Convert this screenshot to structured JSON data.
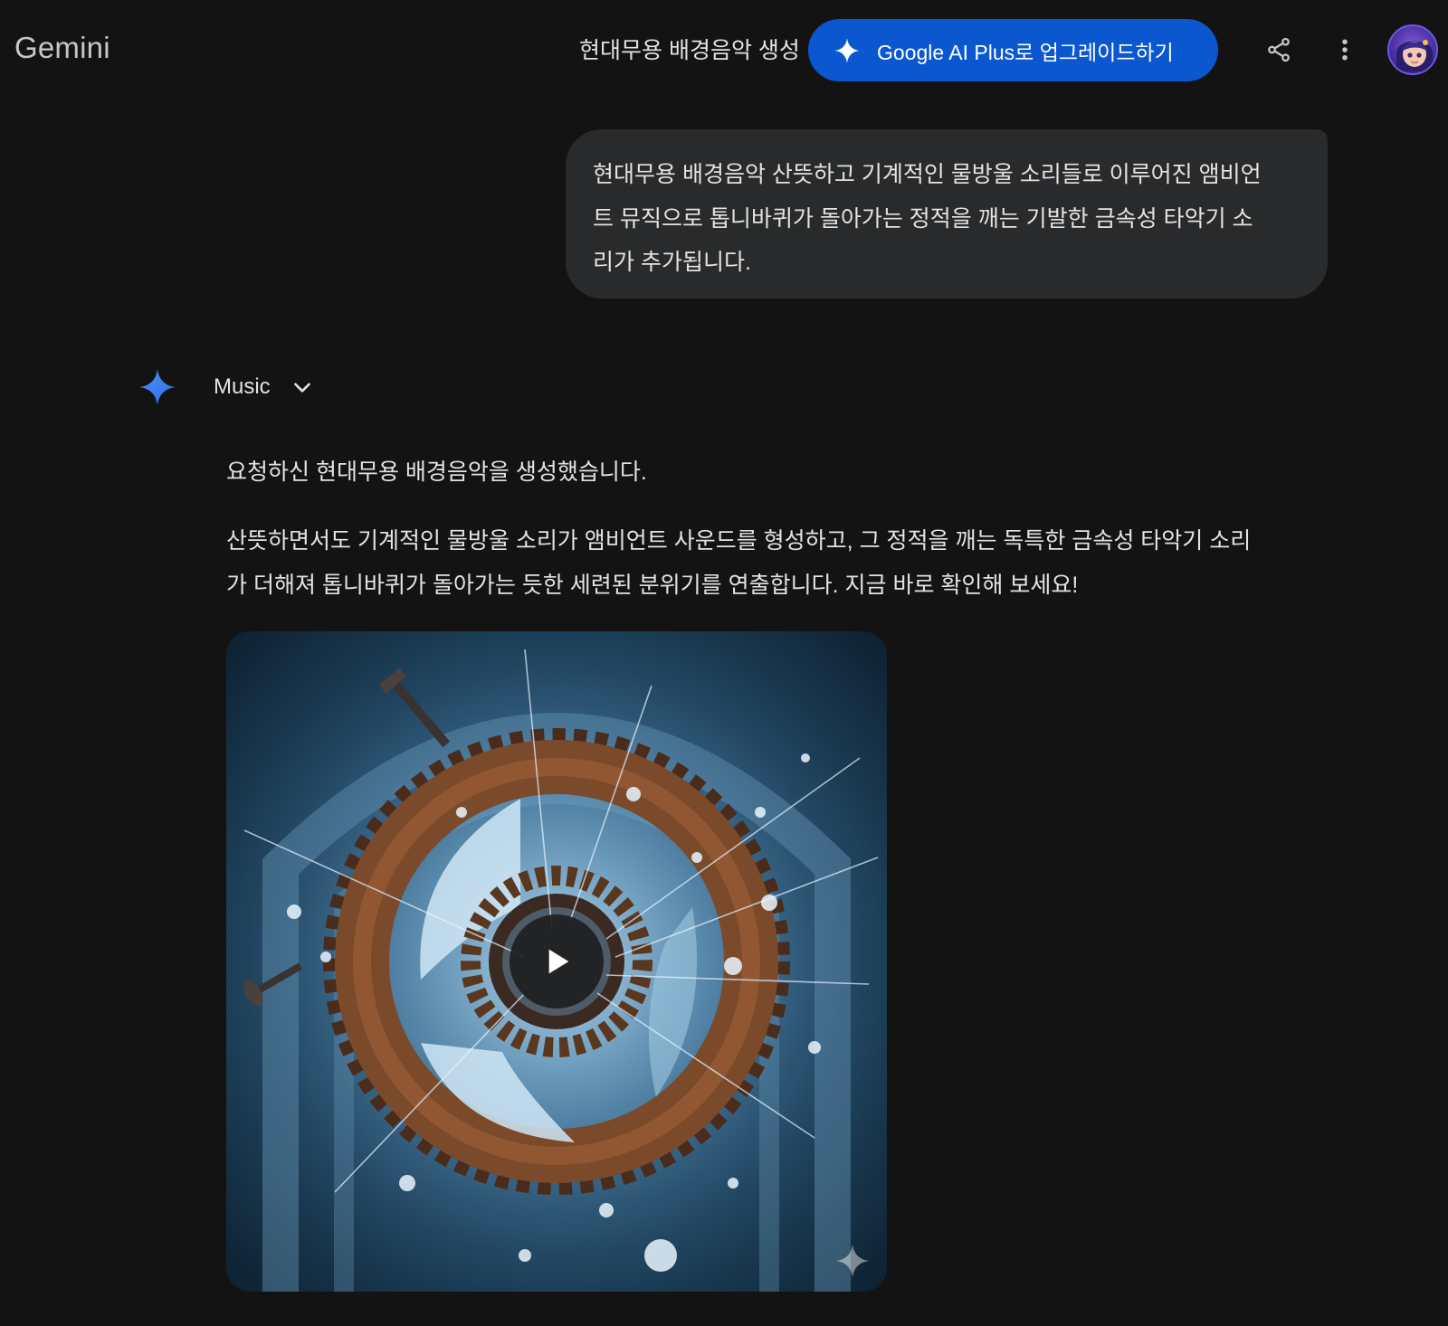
{
  "header": {
    "brand": "Gemini",
    "conversation_title": "현대무용 배경음악 생성",
    "upgrade_label": "Google AI Plus로 업그레이드하기",
    "share_icon": "share-icon",
    "more_icon": "more-vert-icon"
  },
  "user_message": {
    "lines": [
      "현대무용 배경음악 산뜻하고 기계적인 물방울 소리들로 이루어진 앰비언",
      "트 뮤직으로 톱니바퀴가 돌아가는 정적을 깨는 기발한 금속성 타악기 소",
      "리가 추가됩니다."
    ]
  },
  "response": {
    "model_label": "Music",
    "paragraph1": "요청하신 현대무용 배경음악을 생성했습니다.",
    "paragraph2_lines": [
      "산뜻하면서도 기계적인 물방울 소리가 앰비언트 사운드를 형성하고, 그 정적을 깨는 독특한 금속성 타악기 소리",
      "가 더해져 톱니바퀴가 돌아가는 듯한 세련된 분위기를 연출합니다. 지금 바로 확인해 보세요!"
    ],
    "media": {
      "play_icon": "play-icon",
      "watermark_icon": "gemini-sparkle-icon"
    }
  },
  "colors": {
    "background": "#131314",
    "upgrade_button": "#0b57d0",
    "user_bubble": "#282a2c",
    "text": "#e3e3e3"
  }
}
